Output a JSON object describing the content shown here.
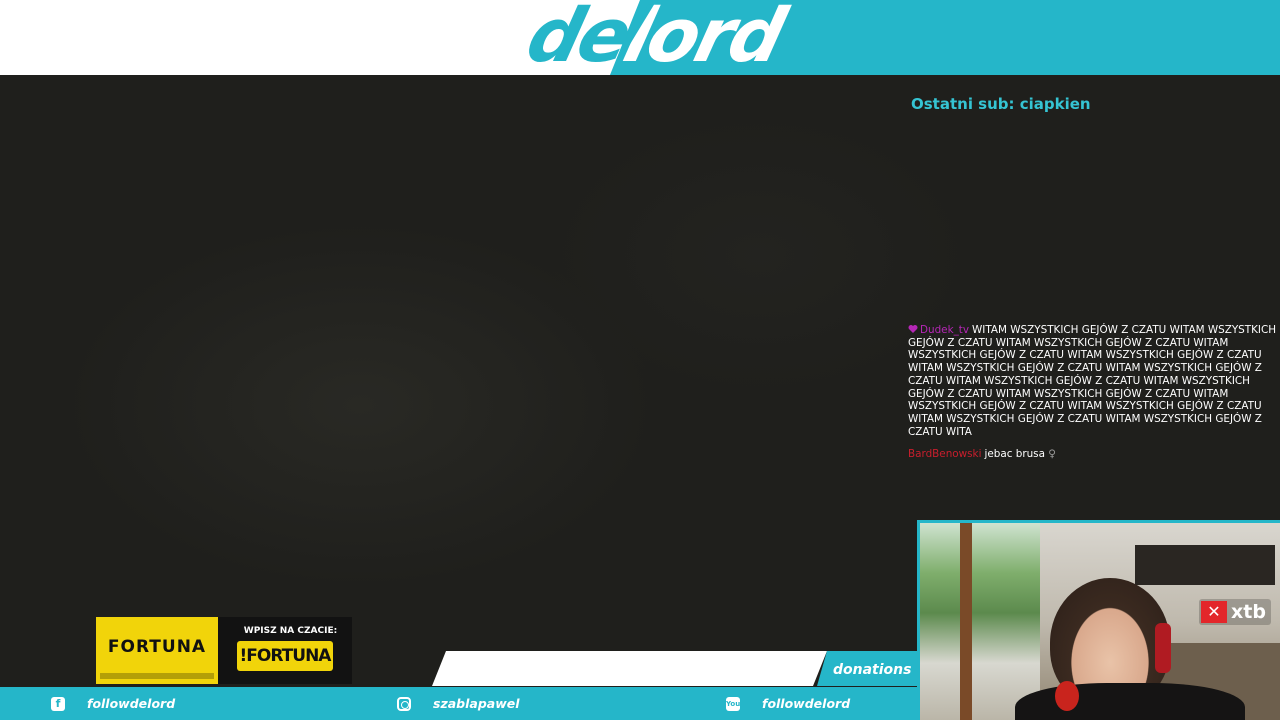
{
  "header": {
    "logo_text": "delord",
    "colors": {
      "teal": "#25b6c9",
      "white": "#ffffff"
    }
  },
  "overlay": {
    "last_sub": "Ostatni sub: ciapkien"
  },
  "chat": {
    "messages": [
      {
        "badge_icon": "heart-badge-icon",
        "username": "Dudek_tv",
        "username_color": "#b527b5",
        "text": "WITAM WSZYSTKICH GEJÓW Z CZATU WITAM WSZYSTKICH GEJÓW Z CZATU WITAM WSZYSTKICH GEJÓW Z CZATU WITAM WSZYSTKICH GEJÓW Z CZATU WITAM WSZYSTKICH GEJÓW Z CZATU WITAM WSZYSTKICH GEJÓW Z CZATU WITAM WSZYSTKICH GEJÓW Z CZATU WITAM WSZYSTKICH GEJÓW Z CZATU WITAM WSZYSTKICH GEJÓW Z CZATU WITAM WSZYSTKICH GEJÓW Z CZATU WITAM WSZYSTKICH GEJÓW Z CZATU WITAM WSZYSTKICH GEJÓW Z CZATU WITAM WSZYSTKICH GEJÓW Z CZATU WITAM WSZYSTKICH GEJÓW Z CZATU WITA"
      },
      {
        "username": "BardBenowski",
        "username_color": "#c81e2d",
        "text": "jebac brusa",
        "emote": "♀"
      }
    ]
  },
  "webcam": {
    "sponsor_logo_text": "xtb",
    "sponsor_logo_mark": "✕"
  },
  "ad": {
    "brand": "FORTUNA",
    "cta": "WPISZ NA CZACIE:",
    "code": "!FORTUNA",
    "colors": {
      "yellow": "#f1d40a"
    }
  },
  "donations": {
    "label": "donations"
  },
  "social": {
    "items": [
      {
        "icon": "facebook-icon",
        "glyph": "f",
        "label": "followdelord"
      },
      {
        "icon": "instagram-icon",
        "glyph": "",
        "label": "szablapawel"
      },
      {
        "icon": "youtube-icon",
        "glyph": "You",
        "label": "followdelord"
      }
    ]
  }
}
